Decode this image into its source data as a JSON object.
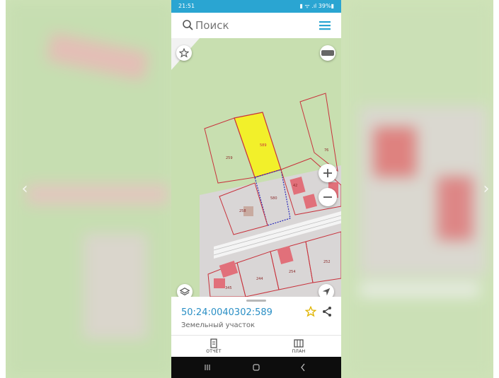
{
  "status_bar": {
    "time": "21:51",
    "icons": "▮ ᯤ .ıl 39%▮"
  },
  "search": {
    "placeholder": "Поиск"
  },
  "map": {
    "labels": [
      {
        "id": "selected",
        "text": "589"
      },
      {
        "id": "left-top",
        "text": "259"
      },
      {
        "id": "right-top",
        "text": "76"
      },
      {
        "id": "center",
        "text": "580"
      },
      {
        "id": "right-mid",
        "text": "42"
      },
      {
        "id": "left-mid",
        "text": "258"
      },
      {
        "id": "right-bottom",
        "text": "252"
      },
      {
        "id": "bottom-mid",
        "text": "254"
      },
      {
        "id": "bottom-left",
        "text": "244"
      },
      {
        "id": "bottom-corner",
        "text": "345"
      }
    ],
    "layers_badge": "слои"
  },
  "parcel": {
    "cadastral_number": "50:24:0040302:589",
    "type": "Земельный участок"
  },
  "tabs": [
    {
      "label": "ОТЧЁТ"
    },
    {
      "label": "ПЛАН"
    }
  ],
  "colors": {
    "accent": "#2aa5d2",
    "link": "#2a8fc5",
    "parcel_border": "#c8323c",
    "selected_fill": "#f2f02a",
    "favorite": "#e0b400"
  },
  "icons": [
    "search-icon",
    "menu-icon",
    "star-icon",
    "layers-icon",
    "zoom-in-icon",
    "zoom-out-icon",
    "locate-icon",
    "share-icon",
    "report-icon",
    "plan-icon"
  ]
}
